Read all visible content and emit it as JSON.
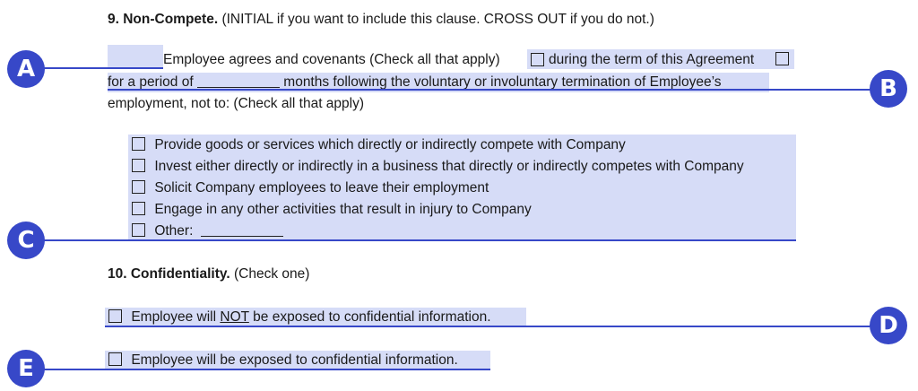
{
  "section9": {
    "heading": "9. Non-Compete.",
    "instruction": "(INITIAL if you want to include this clause. CROSS OUT if you do not.)",
    "line1": "Employee agrees and covenants (Check all that apply)",
    "opt_during": "during the term of this Agreement",
    "line2a": "for a period of",
    "line2b": "months following the voluntary or involuntary termination of Employee’s",
    "line3": "employment, not to: (Check all that apply)",
    "items": [
      "Provide goods or services which directly or indirectly compete with Company",
      "Invest either directly or indirectly in a business that directly or indirectly competes with Company",
      "Solicit Company employees to leave their employment",
      "Engage in any other activities that result in injury to Company",
      "Other:"
    ]
  },
  "section10": {
    "heading": "10. Confidentiality.",
    "instruction": "(Check one)",
    "opt_not_pre": "Employee will",
    "opt_not_word": "NOT",
    "opt_not_post": "be exposed to confidential information.",
    "opt_yes": "Employee will be exposed to confidential information."
  },
  "markers": {
    "a": "A",
    "b": "B",
    "c": "C",
    "d": "D",
    "e": "E"
  },
  "colors": {
    "highlight": "#d6dcf7",
    "marker": "#3748c8"
  }
}
